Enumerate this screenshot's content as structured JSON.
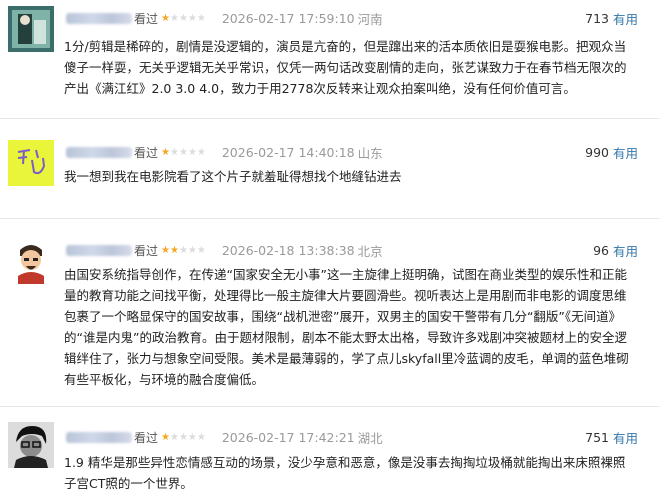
{
  "reviews": [
    {
      "label": "看过",
      "rating": 1,
      "time": "2026-02-17 17:59:10",
      "location": "河南",
      "useful_count": "713",
      "useful_label": "有用",
      "text": "1分/剪辑是稀碎的，剧情是没逻辑的，演员是亢奋的，但是蹿出来的活本质依旧是耍猴电影。把观众当傻子一样耍，无关乎逻辑无关乎常识，仅凭一两句话改变剧情的走向，张艺谋致力于在春节档无限次的产出《满江红》2.0 3.0 4.0，致力于用2778次反转来让观众拍案叫绝，没有任何价值可言。"
    },
    {
      "label": "看过",
      "rating": 1,
      "time": "2026-02-17 14:40:18",
      "location": "山东",
      "useful_count": "990",
      "useful_label": "有用",
      "text": "我一想到我在电影院看了这个片子就羞耻得想找个地缝钻进去"
    },
    {
      "label": "看过",
      "rating": 2,
      "time": "2026-02-18 13:38:38",
      "location": "北京",
      "useful_count": "96",
      "useful_label": "有用",
      "text": "由国安系统指导创作，在传递“国家安全无小事”这一主旋律上挺明确，试图在商业类型的娱乐性和正能量的教育功能之间找平衡，处理得比一般主旋律大片要圆滑些。视听表达上是用剧而非电影的调度思维包裹了一个略显保守的国安故事，围绕“战机泄密”展开，双男主的国安干警带有几分“翻版”《无间道》的“谁是内鬼”的政治教育。由于题材限制，剧本不能太野太出格，导致许多戏剧冲突被题材上的安全逻辑绊住了，张力与想象空间受限。美术是最薄弱的，学了点儿skyfall里冷蓝调的皮毛，单调的蓝色堆砌有些平板化，与环境的融合度偏低。"
    },
    {
      "label": "看过",
      "rating": 1,
      "time": "2026-02-17 17:42:21",
      "location": "湖北",
      "useful_count": "751",
      "useful_label": "有用",
      "text": "1.9 精华是那些异性恋情感互动的场景，没少孕意和恶意，像是没事去掏掏垃圾桶就能掏出来床照裸照子宫CT照的一个世界。"
    }
  ]
}
